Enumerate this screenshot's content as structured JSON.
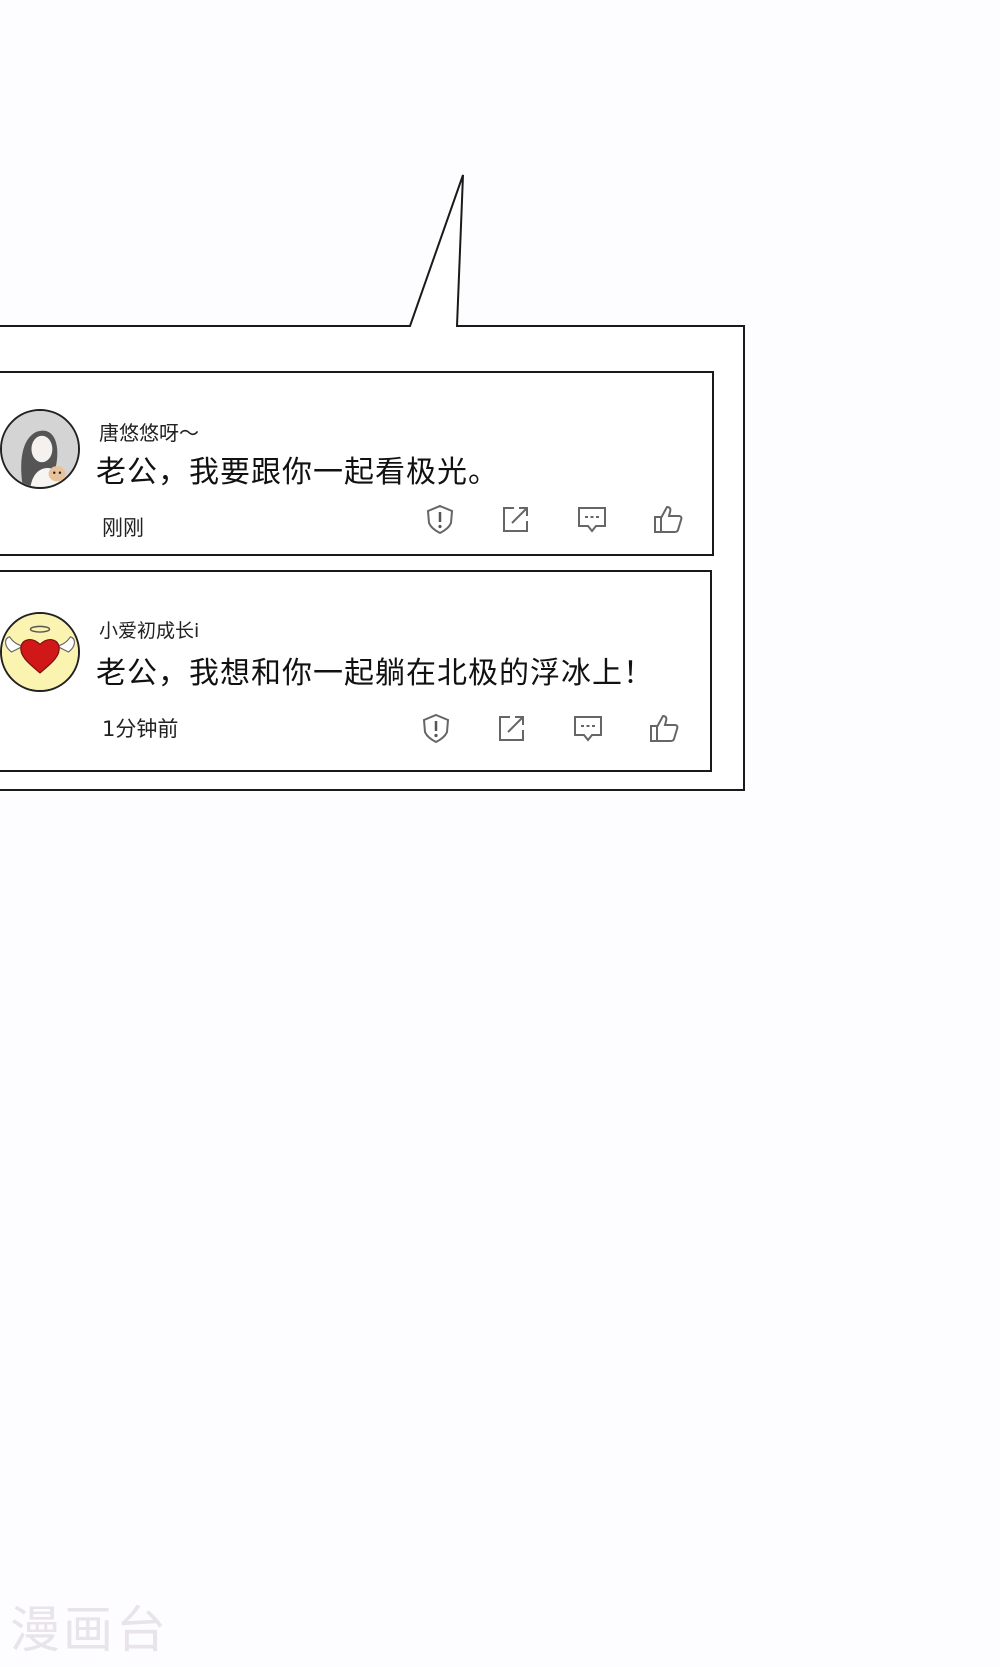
{
  "comments": [
    {
      "username": "唐悠悠呀～",
      "text": "老公，我要跟你一起看极光。",
      "time": "刚刚",
      "avatar_icon": "woman-with-cat-avatar"
    },
    {
      "username": "小爱初成长i",
      "text": "老公，我想和你一起躺在北极的浮冰上！",
      "time": "1分钟前",
      "avatar_icon": "winged-heart-avatar"
    }
  ],
  "action_icons": [
    "report-icon",
    "share-icon",
    "reply-icon",
    "like-icon"
  ],
  "watermark": "漫画台",
  "colors": {
    "background": "#fdfcfe",
    "border": "#1a1a1a",
    "heart": "#d01818",
    "avatar2_bg": "#fbf3b0"
  }
}
